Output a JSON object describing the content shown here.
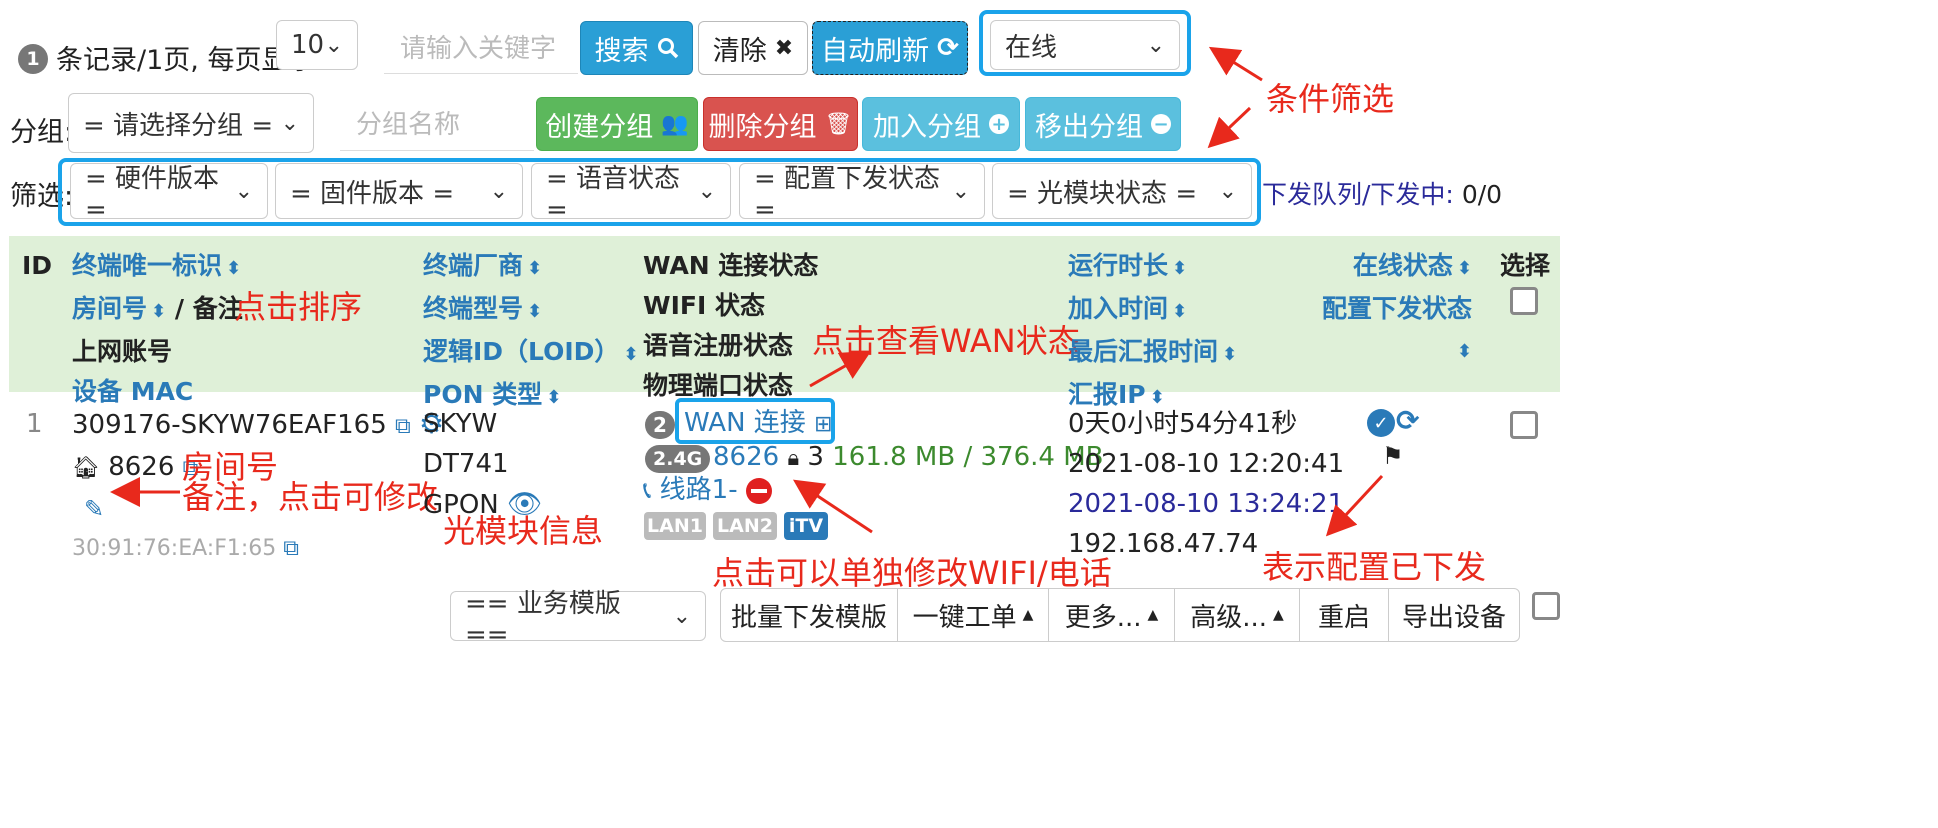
{
  "toolbar": {
    "record_count": "1",
    "records_text": "条记录/1页, 每页显示",
    "page_size": "10",
    "keyword_placeholder": "请输入关键字",
    "search_label": "搜索",
    "clear_label": "清除",
    "auto_refresh_label": "自动刷新",
    "status_filter": "在线"
  },
  "group": {
    "label": "分组:",
    "select": "= 请选择分组 =",
    "name_placeholder": "分组名称",
    "create_label": "创建分组",
    "delete_label": "删除分组",
    "add_label": "加入分组",
    "remove_label": "移出分组"
  },
  "filter": {
    "label": "筛选:",
    "hardware": "= 硬件版本 =",
    "firmware": "= 固件版本 =",
    "voice": "= 语音状态 =",
    "config": "= 配置下发状态 =",
    "optical": "= 光模块状态 =",
    "queue_label": "下发队列/下发中:",
    "queue_value": "0/0"
  },
  "headers": {
    "id": "ID",
    "uid": "终端唯一标识",
    "room": "房间号",
    "slash": "/",
    "remark": "备注",
    "account": "上网账号",
    "mac": "设备 MAC",
    "vendor": "终端厂商",
    "model": "终端型号",
    "loid": "逻辑ID（LOID）",
    "pon": "PON 类型",
    "wan": "WAN 连接状态",
    "wifi": "WIFI 状态",
    "voice_reg": "语音注册状态",
    "port": "物理端口状态",
    "uptime": "运行时长",
    "join_time": "加入时间",
    "last_report": "最后汇报时间",
    "report_ip": "汇报IP",
    "online": "在线状态",
    "config_status": "配置下发状态",
    "select": "选择"
  },
  "row": {
    "id": "1",
    "uid": "309176-SKYW76EAF165",
    "room": "8626",
    "mac": "30:91:76:EA:F1:65",
    "vendor": "SKYW",
    "model": "DT741",
    "pon": "GPON",
    "wan_count": "2",
    "wan_label": "WAN 连接",
    "band": "2.4G",
    "ssid": "8626",
    "clients": "3",
    "traffic": "161.8 MB / 376.4 MB",
    "line_label": "线路1-",
    "ports": [
      "LAN1",
      "LAN2",
      "iTV"
    ],
    "uptime": "0天0小时54分41秒",
    "join_time": "2021-08-10 12:20:41",
    "last_report": "2021-08-10 13:24:21",
    "report_ip": "192.168.47.74"
  },
  "annotations": {
    "filter": "条件筛选",
    "sort": "点击排序",
    "wan": "点击查看WAN状态",
    "room": "房间号",
    "remark": "备注，点击可修改",
    "optical": "光模块信息",
    "wifi_phone": "点击可以单独修改WIFI/电话",
    "config_sent": "表示配置已下发"
  },
  "bottom": {
    "template_select": "== 业务模版 ==",
    "batch_label": "批量下发模版",
    "workorder_label": "一键工单",
    "more_label": "更多...",
    "advanced_label": "高级...",
    "reboot_label": "重启",
    "export_label": "导出设备"
  },
  "colors": {
    "accent_blue": "#2a9fd6",
    "highlight_border": "#1aa3ea",
    "header_bg": "#dff0d8",
    "annotation_red": "#e8291c",
    "link_blue": "#2a7ab8",
    "traffic_green": "#3c8a2e"
  }
}
